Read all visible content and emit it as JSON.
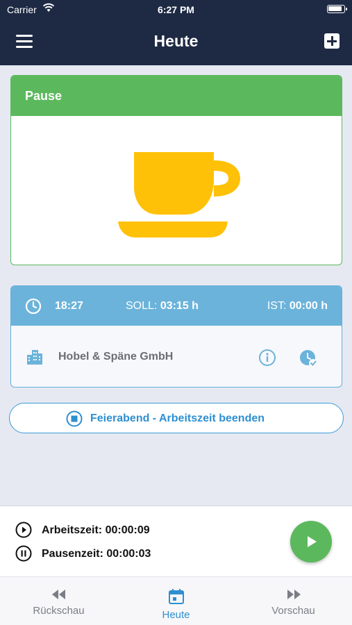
{
  "status_bar": {
    "carrier": "Carrier",
    "time": "6:27 PM"
  },
  "nav": {
    "title": "Heute"
  },
  "pause_card": {
    "title": "Pause"
  },
  "info_card": {
    "time": "18:27",
    "soll_label": "SOLL:",
    "soll_value": "03:15 h",
    "ist_label": "IST:",
    "ist_value": "00:00 h",
    "company": "Hobel & Späne GmbH"
  },
  "end_button": {
    "label": "Feierabend - Arbeitszeit beenden"
  },
  "summary": {
    "work_time": "Arbeitszeit: 00:00:09",
    "pause_time": "Pausenzeit: 00:00:03"
  },
  "tabs": [
    {
      "label": "Rückschau"
    },
    {
      "label": "Heute"
    },
    {
      "label": "Vorschau"
    }
  ],
  "colors": {
    "nav_bg": "#1e2a44",
    "pause_green": "#5cb85c",
    "cup_yellow": "#ffc107",
    "info_blue": "#6bb3da",
    "accent_blue": "#2e8fd1"
  }
}
